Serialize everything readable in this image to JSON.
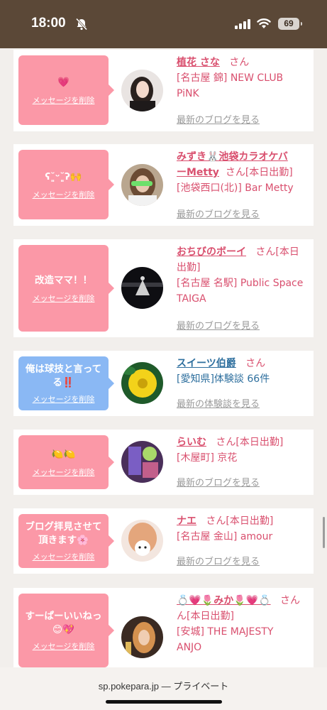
{
  "status_bar": {
    "time": "18:00",
    "battery": "69"
  },
  "cards": [
    {
      "bubble_text": "💗",
      "bubble_color": "pink",
      "delete_label": "メッセージを削除",
      "name": "植花 さな",
      "san": "さん",
      "details": "[名古屋 錦] NEW CLUB PiNK",
      "link": "最新のブログを見る",
      "text_color": "pink"
    },
    {
      "bubble_text": "ʕ˘͈ᵕ˘͈ʔ🙌",
      "bubble_color": "pink",
      "delete_label": "メッセージを削除",
      "name": "みずき🐰池袋カラオケバーMetty",
      "san": "さん",
      "details": "[本日出勤] [池袋西口(北)] Bar Metty",
      "link": "最新のブログを見る",
      "text_color": "pink"
    },
    {
      "bubble_text": "改造ママ！！",
      "bubble_color": "pink",
      "delete_label": "メッセージを削除",
      "name": "おちびのボーイ",
      "san": "さん",
      "details": "[本日出勤] [名古屋 名駅] Public Space TAIGA",
      "link": "最新のブログを見る",
      "text_color": "pink"
    },
    {
      "bubble_text": "俺は球技と言ってる‼️",
      "bubble_color": "blue",
      "delete_label": "メッセージを削除",
      "name": "スイーツ伯爵",
      "san": "さん",
      "details": "[愛知県]体験談 66件",
      "link": "最新の体験談を見る",
      "text_color": "blue"
    },
    {
      "bubble_text": "🍋🍋",
      "bubble_color": "pink",
      "delete_label": "メッセージを削除",
      "name": "らいむ",
      "san": "さん",
      "details": "[本日出勤] [木屋町] 京花",
      "link": "最新のブログを見る",
      "text_color": "pink"
    },
    {
      "bubble_text": "ブログ拝見させて頂きます🌸",
      "bubble_color": "pink",
      "delete_label": "メッセージを削除",
      "name": "ナエ",
      "san": "さん",
      "details": "[本日出勤] [名古屋 金山] amour",
      "link": "最新のブログを見る",
      "text_color": "pink"
    },
    {
      "bubble_text": "すーぱーいいねっ😊💖",
      "bubble_color": "pink",
      "delete_label": "メッセージを削除",
      "name": "💍💗🌷みか🌷💗💍",
      "san": "さん",
      "details": "[本日出勤] [安城] THE MAJESTY ANJO",
      "link": "",
      "text_color": "pink"
    }
  ],
  "card_lines": {
    "c0": {
      "name": "植花 さな",
      "l1": "[名古屋 錦] NEW CLUB",
      "l2": "PiNK"
    },
    "c1": {
      "name1": "みずき🐰池袋カラオケバ",
      "name2": "ーMetty",
      "l1tail": "[本日出勤]",
      "l2": "[池袋西口(北)] Bar Metty"
    },
    "c2": {
      "name": "おちびのボーイ",
      "tail": "[本日",
      "l1": "出勤]",
      "l2": "[名古屋 名駅] Public Space",
      "l3": "TAIGA"
    },
    "c3": {
      "name": "スイーツ伯爵",
      "l1": "[愛知県]体験談 66件"
    },
    "c4": {
      "name": "らいむ",
      "tail": "[本日出勤]",
      "l1": "[木屋町] 京花"
    },
    "c5": {
      "name": "ナエ",
      "tail": "[本日出勤]",
      "l1": "[名古屋 金山] amour"
    },
    "c6": {
      "name": "💍💗🌷みか🌷💗💍",
      "l1": "ん[本日出勤]",
      "l2": "[安城] THE MAJESTY",
      "l3": "ANJO"
    }
  },
  "bubble_lines": {
    "b1": "ʕ˘͈ᵕ˘͈ʔ🙌",
    "b3a": "俺は球技と言って",
    "b3b": "る‼️",
    "b5a": "ブログ拝見させて",
    "b5b": "頂きます🌸",
    "b6a": "すーぱーいいねっ",
    "b6b": "😊💖"
  },
  "url_bar": {
    "url": "sp.pokepara.jp — プライベート"
  },
  "colors": {
    "pink_bubble": "#fb98a7",
    "blue_bubble": "#8ab8f4",
    "name_pink": "#d94f6e",
    "name_blue": "#2e6f9e",
    "header": "#5b4837"
  }
}
